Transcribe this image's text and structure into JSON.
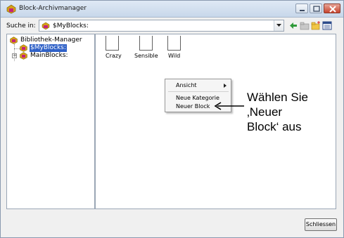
{
  "window": {
    "title": "Block-Archivmanager"
  },
  "search": {
    "label": "Suche in:",
    "current_value": "$MyBlocks:"
  },
  "tree": {
    "items": [
      {
        "label": "Bibliothek-Manager",
        "icon": "library-icon",
        "selected": false
      },
      {
        "label": "$MyBlocks:",
        "icon": "block-folder-icon",
        "selected": true
      },
      {
        "label": "MainBlocks:",
        "icon": "block-folder-icon",
        "selected": false,
        "expander": "+"
      }
    ]
  },
  "blocks": [
    {
      "label": "Crazy"
    },
    {
      "label": "Sensible"
    },
    {
      "label": "Wild"
    }
  ],
  "context_menu": {
    "items": [
      {
        "label": "Ansicht",
        "has_submenu": true
      },
      {
        "label": "Neue Kategorie"
      },
      {
        "label": "Neuer Block"
      }
    ]
  },
  "annotation": {
    "line1": "Wählen Sie",
    "line2": "‚Neuer",
    "line3": "Block‘ aus"
  },
  "footer": {
    "close_label": "Schliessen"
  },
  "colors": {
    "selection": "#3062c8",
    "panel_border": "#9aa6b5",
    "window_bg": "#f0f0f0"
  }
}
